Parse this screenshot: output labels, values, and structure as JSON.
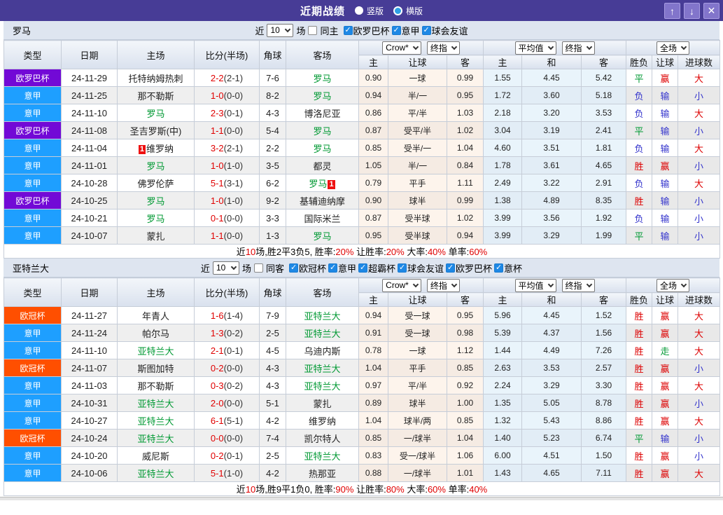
{
  "titlebar": {
    "title": "近期战绩",
    "radio_vertical": "竖版",
    "radio_horizontal": "横版",
    "up_button": "↑",
    "down_button": "↓",
    "close_button": "✕"
  },
  "colors": {
    "titlebar_purple": "#473c96",
    "league_europa": "#7209d6",
    "league_serie_a": "#1e9fff",
    "league_ucl": "#ff4f00",
    "team_green": "#009933",
    "score_red": "#e00000",
    "result_red": "#dd0000",
    "result_green": "#009933",
    "result_blue": "#3333cc",
    "checkbox_blue": "#1e88e5"
  },
  "table_header": {
    "plain_cols": [
      "类型",
      "日期",
      "主场",
      "比分(半场)",
      "角球",
      "客场"
    ],
    "dd_company": "Crow*",
    "dd_final_a": "终指",
    "dd_avg": "平均值",
    "dd_final_b": "终指",
    "dd_scope": "全场",
    "sub_cols": [
      "主",
      "让球",
      "客",
      "主",
      "和",
      "客",
      "胜负",
      "让球",
      "进球数"
    ]
  },
  "sections": [
    {
      "team": "罗马",
      "filter": {
        "near_label": "近",
        "count": "10",
        "unit_label": "场",
        "same_label": "同主",
        "same_checked": false,
        "leagues": [
          "欧罗巴杯",
          "意甲",
          "球会友谊"
        ]
      },
      "rows": [
        {
          "league": "欧罗巴杯",
          "league_type": "europa",
          "date": "24-11-29",
          "home": "托特纳姆热刺",
          "home_focus": false,
          "home_badge": "",
          "score_ft": "2-2",
          "score_ht": "(2-1)",
          "corners": "7-6",
          "away": "罗马",
          "away_focus": true,
          "away_badge": "",
          "odds": [
            "0.90",
            "一球",
            "0.99"
          ],
          "avg": [
            "1.55",
            "4.45",
            "5.42"
          ],
          "r": [
            "平",
            "赢",
            "大"
          ],
          "rc": [
            "green",
            "red",
            "red"
          ]
        },
        {
          "league": "意甲",
          "league_type": "serie_a",
          "date": "24-11-25",
          "home": "那不勒斯",
          "home_focus": false,
          "home_badge": "",
          "score_ft": "1-0",
          "score_ht": "(0-0)",
          "corners": "8-2",
          "away": "罗马",
          "away_focus": true,
          "away_badge": "",
          "odds": [
            "0.94",
            "半/一",
            "0.95"
          ],
          "avg": [
            "1.72",
            "3.60",
            "5.18"
          ],
          "r": [
            "负",
            "输",
            "小"
          ],
          "rc": [
            "blue",
            "blue",
            "blue"
          ]
        },
        {
          "league": "意甲",
          "league_type": "serie_a",
          "date": "24-11-10",
          "home": "罗马",
          "home_focus": true,
          "home_badge": "",
          "score_ft": "2-3",
          "score_ht": "(0-1)",
          "corners": "4-3",
          "away": "博洛尼亚",
          "away_focus": false,
          "away_badge": "",
          "odds": [
            "0.86",
            "平/半",
            "1.03"
          ],
          "avg": [
            "2.18",
            "3.20",
            "3.53"
          ],
          "r": [
            "负",
            "输",
            "大"
          ],
          "rc": [
            "blue",
            "blue",
            "red"
          ]
        },
        {
          "league": "欧罗巴杯",
          "league_type": "europa",
          "date": "24-11-08",
          "home": "圣吉罗斯(中)",
          "home_focus": false,
          "home_badge": "",
          "score_ft": "1-1",
          "score_ht": "(0-0)",
          "corners": "5-4",
          "away": "罗马",
          "away_focus": true,
          "away_badge": "",
          "odds": [
            "0.87",
            "受平/半",
            "1.02"
          ],
          "avg": [
            "3.04",
            "3.19",
            "2.41"
          ],
          "r": [
            "平",
            "输",
            "小"
          ],
          "rc": [
            "green",
            "blue",
            "blue"
          ]
        },
        {
          "league": "意甲",
          "league_type": "serie_a",
          "date": "24-11-04",
          "home": "维罗纳",
          "home_focus": false,
          "home_badge": "1",
          "score_ft": "3-2",
          "score_ht": "(2-1)",
          "corners": "2-2",
          "away": "罗马",
          "away_focus": true,
          "away_badge": "",
          "odds": [
            "0.85",
            "受半/一",
            "1.04"
          ],
          "avg": [
            "4.60",
            "3.51",
            "1.81"
          ],
          "r": [
            "负",
            "输",
            "大"
          ],
          "rc": [
            "blue",
            "blue",
            "red"
          ]
        },
        {
          "league": "意甲",
          "league_type": "serie_a",
          "date": "24-11-01",
          "home": "罗马",
          "home_focus": true,
          "home_badge": "",
          "score_ft": "1-0",
          "score_ht": "(1-0)",
          "corners": "3-5",
          "away": "都灵",
          "away_focus": false,
          "away_badge": "",
          "odds": [
            "1.05",
            "半/一",
            "0.84"
          ],
          "avg": [
            "1.78",
            "3.61",
            "4.65"
          ],
          "r": [
            "胜",
            "赢",
            "小"
          ],
          "rc": [
            "red",
            "red",
            "blue"
          ]
        },
        {
          "league": "意甲",
          "league_type": "serie_a",
          "date": "24-10-28",
          "home": "佛罗伦萨",
          "home_focus": false,
          "home_badge": "",
          "score_ft": "5-1",
          "score_ht": "(3-1)",
          "corners": "6-2",
          "away": "罗马",
          "away_focus": true,
          "away_badge": "1",
          "odds": [
            "0.79",
            "平手",
            "1.11"
          ],
          "avg": [
            "2.49",
            "3.22",
            "2.91"
          ],
          "r": [
            "负",
            "输",
            "大"
          ],
          "rc": [
            "blue",
            "blue",
            "red"
          ]
        },
        {
          "league": "欧罗巴杯",
          "league_type": "europa",
          "date": "24-10-25",
          "home": "罗马",
          "home_focus": true,
          "home_badge": "",
          "score_ft": "1-0",
          "score_ht": "(1-0)",
          "corners": "9-2",
          "away": "基辅迪纳摩",
          "away_focus": false,
          "away_badge": "",
          "odds": [
            "0.90",
            "球半",
            "0.99"
          ],
          "avg": [
            "1.38",
            "4.89",
            "8.35"
          ],
          "r": [
            "胜",
            "输",
            "小"
          ],
          "rc": [
            "red",
            "blue",
            "blue"
          ]
        },
        {
          "league": "意甲",
          "league_type": "serie_a",
          "date": "24-10-21",
          "home": "罗马",
          "home_focus": true,
          "home_badge": "",
          "score_ft": "0-1",
          "score_ht": "(0-0)",
          "corners": "3-3",
          "away": "国际米兰",
          "away_focus": false,
          "away_badge": "",
          "odds": [
            "0.87",
            "受半球",
            "1.02"
          ],
          "avg": [
            "3.99",
            "3.56",
            "1.92"
          ],
          "r": [
            "负",
            "输",
            "小"
          ],
          "rc": [
            "blue",
            "blue",
            "blue"
          ]
        },
        {
          "league": "意甲",
          "league_type": "serie_a",
          "date": "24-10-07",
          "home": "蒙扎",
          "home_focus": false,
          "home_badge": "",
          "score_ft": "1-1",
          "score_ht": "(0-0)",
          "corners": "1-3",
          "away": "罗马",
          "away_focus": true,
          "away_badge": "",
          "odds": [
            "0.95",
            "受半球",
            "0.94"
          ],
          "avg": [
            "3.99",
            "3.29",
            "1.99"
          ],
          "r": [
            "平",
            "输",
            "小"
          ],
          "rc": [
            "green",
            "blue",
            "blue"
          ]
        }
      ],
      "summary": [
        {
          "t": "近",
          "red": false
        },
        {
          "t": "10",
          "red": true
        },
        {
          "t": "场,胜2平3负5, 胜率:",
          "red": false
        },
        {
          "t": "20%",
          "red": true
        },
        {
          "t": " 让胜率:",
          "red": false
        },
        {
          "t": "20%",
          "red": true
        },
        {
          "t": " 大率:",
          "red": false
        },
        {
          "t": "40%",
          "red": true
        },
        {
          "t": " 单率:",
          "red": false
        },
        {
          "t": "60%",
          "red": true
        }
      ]
    },
    {
      "team": "亚特兰大",
      "filter": {
        "near_label": "近",
        "count": "10",
        "unit_label": "场",
        "same_label": "同客",
        "same_checked": false,
        "leagues": [
          "欧冠杯",
          "意甲",
          "超霸杯",
          "球会友谊",
          "欧罗巴杯",
          "意杯"
        ]
      },
      "rows": [
        {
          "league": "欧冠杯",
          "league_type": "ucl",
          "date": "24-11-27",
          "home": "年青人",
          "home_focus": false,
          "home_badge": "",
          "score_ft": "1-6",
          "score_ht": "(1-4)",
          "corners": "7-9",
          "away": "亚特兰大",
          "away_focus": true,
          "away_badge": "",
          "odds": [
            "0.94",
            "受一球",
            "0.95"
          ],
          "avg": [
            "5.96",
            "4.45",
            "1.52"
          ],
          "r": [
            "胜",
            "赢",
            "大"
          ],
          "rc": [
            "red",
            "red",
            "red"
          ]
        },
        {
          "league": "意甲",
          "league_type": "serie_a",
          "date": "24-11-24",
          "home": "帕尔马",
          "home_focus": false,
          "home_badge": "",
          "score_ft": "1-3",
          "score_ht": "(0-2)",
          "corners": "2-5",
          "away": "亚特兰大",
          "away_focus": true,
          "away_badge": "",
          "odds": [
            "0.91",
            "受一球",
            "0.98"
          ],
          "avg": [
            "5.39",
            "4.37",
            "1.56"
          ],
          "r": [
            "胜",
            "赢",
            "大"
          ],
          "rc": [
            "red",
            "red",
            "red"
          ]
        },
        {
          "league": "意甲",
          "league_type": "serie_a",
          "date": "24-11-10",
          "home": "亚特兰大",
          "home_focus": true,
          "home_badge": "",
          "score_ft": "2-1",
          "score_ht": "(0-1)",
          "corners": "4-5",
          "away": "乌迪内斯",
          "away_focus": false,
          "away_badge": "",
          "odds": [
            "0.78",
            "一球",
            "1.12"
          ],
          "avg": [
            "1.44",
            "4.49",
            "7.26"
          ],
          "r": [
            "胜",
            "走",
            "大"
          ],
          "rc": [
            "red",
            "green",
            "red"
          ]
        },
        {
          "league": "欧冠杯",
          "league_type": "ucl",
          "date": "24-11-07",
          "home": "斯图加特",
          "home_focus": false,
          "home_badge": "",
          "score_ft": "0-2",
          "score_ht": "(0-0)",
          "corners": "4-3",
          "away": "亚特兰大",
          "away_focus": true,
          "away_badge": "",
          "odds": [
            "1.04",
            "平手",
            "0.85"
          ],
          "avg": [
            "2.63",
            "3.53",
            "2.57"
          ],
          "r": [
            "胜",
            "赢",
            "小"
          ],
          "rc": [
            "red",
            "red",
            "blue"
          ]
        },
        {
          "league": "意甲",
          "league_type": "serie_a",
          "date": "24-11-03",
          "home": "那不勒斯",
          "home_focus": false,
          "home_badge": "",
          "score_ft": "0-3",
          "score_ht": "(0-2)",
          "corners": "4-3",
          "away": "亚特兰大",
          "away_focus": true,
          "away_badge": "",
          "odds": [
            "0.97",
            "平/半",
            "0.92"
          ],
          "avg": [
            "2.24",
            "3.29",
            "3.30"
          ],
          "r": [
            "胜",
            "赢",
            "大"
          ],
          "rc": [
            "red",
            "red",
            "red"
          ]
        },
        {
          "league": "意甲",
          "league_type": "serie_a",
          "date": "24-10-31",
          "home": "亚特兰大",
          "home_focus": true,
          "home_badge": "",
          "score_ft": "2-0",
          "score_ht": "(0-0)",
          "corners": "5-1",
          "away": "蒙扎",
          "away_focus": false,
          "away_badge": "",
          "odds": [
            "0.89",
            "球半",
            "1.00"
          ],
          "avg": [
            "1.35",
            "5.05",
            "8.78"
          ],
          "r": [
            "胜",
            "赢",
            "小"
          ],
          "rc": [
            "red",
            "red",
            "blue"
          ]
        },
        {
          "league": "意甲",
          "league_type": "serie_a",
          "date": "24-10-27",
          "home": "亚特兰大",
          "home_focus": true,
          "home_badge": "",
          "score_ft": "6-1",
          "score_ht": "(5-1)",
          "corners": "4-2",
          "away": "维罗纳",
          "away_focus": false,
          "away_badge": "",
          "odds": [
            "1.04",
            "球半/两",
            "0.85"
          ],
          "avg": [
            "1.32",
            "5.43",
            "8.86"
          ],
          "r": [
            "胜",
            "赢",
            "大"
          ],
          "rc": [
            "red",
            "red",
            "red"
          ]
        },
        {
          "league": "欧冠杯",
          "league_type": "ucl",
          "date": "24-10-24",
          "home": "亚特兰大",
          "home_focus": true,
          "home_badge": "",
          "score_ft": "0-0",
          "score_ht": "(0-0)",
          "corners": "7-4",
          "away": "凯尔特人",
          "away_focus": false,
          "away_badge": "",
          "odds": [
            "0.85",
            "一/球半",
            "1.04"
          ],
          "avg": [
            "1.40",
            "5.23",
            "6.74"
          ],
          "r": [
            "平",
            "输",
            "小"
          ],
          "rc": [
            "green",
            "blue",
            "blue"
          ]
        },
        {
          "league": "意甲",
          "league_type": "serie_a",
          "date": "24-10-20",
          "home": "威尼斯",
          "home_focus": false,
          "home_badge": "",
          "score_ft": "0-2",
          "score_ht": "(0-1)",
          "corners": "2-5",
          "away": "亚特兰大",
          "away_focus": true,
          "away_badge": "",
          "odds": [
            "0.83",
            "受一/球半",
            "1.06"
          ],
          "avg": [
            "6.00",
            "4.51",
            "1.50"
          ],
          "r": [
            "胜",
            "赢",
            "小"
          ],
          "rc": [
            "red",
            "red",
            "blue"
          ]
        },
        {
          "league": "意甲",
          "league_type": "serie_a",
          "date": "24-10-06",
          "home": "亚特兰大",
          "home_focus": true,
          "home_badge": "",
          "score_ft": "5-1",
          "score_ht": "(1-0)",
          "corners": "4-2",
          "away": "热那亚",
          "away_focus": false,
          "away_badge": "",
          "odds": [
            "0.88",
            "一/球半",
            "1.01"
          ],
          "avg": [
            "1.43",
            "4.65",
            "7.11"
          ],
          "r": [
            "胜",
            "赢",
            "大"
          ],
          "rc": [
            "red",
            "red",
            "red"
          ]
        }
      ],
      "summary": [
        {
          "t": "近",
          "red": false
        },
        {
          "t": "10",
          "red": true
        },
        {
          "t": "场,胜9平1负0, 胜率:",
          "red": false
        },
        {
          "t": "90%",
          "red": true
        },
        {
          "t": " 让胜率:",
          "red": false
        },
        {
          "t": "80%",
          "red": true
        },
        {
          "t": " 大率:",
          "red": false
        },
        {
          "t": "60%",
          "red": true
        },
        {
          "t": " 单率:",
          "red": false
        },
        {
          "t": "40%",
          "red": true
        }
      ]
    }
  ]
}
